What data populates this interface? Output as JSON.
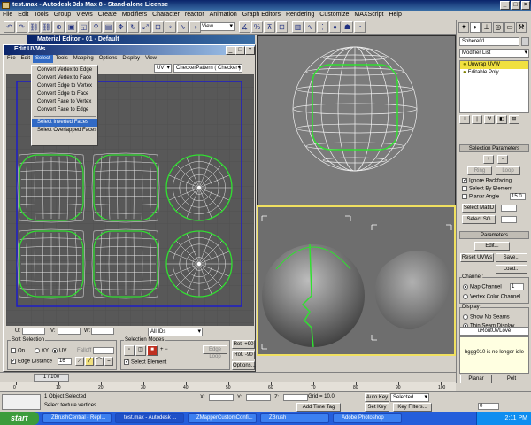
{
  "app": {
    "title": "test.max - Autodesk 3ds Max 8 - Stand-alone License"
  },
  "menu": [
    "File",
    "Edit",
    "Tools",
    "Group",
    "Views",
    "Create",
    "Modifiers",
    "Character",
    "reactor",
    "Animation",
    "Graph Editors",
    "Rendering",
    "Customize",
    "MAXScript",
    "Help"
  ],
  "toolbar": {
    "view_dropdown": "View"
  },
  "material_editor": {
    "title": "Material Editor - 01 - Default"
  },
  "uvw": {
    "title": "Edit UVWs",
    "menu": [
      "File",
      "Edit",
      "Select",
      "Tools",
      "Mapping",
      "Options",
      "Display",
      "View"
    ],
    "uv_dropdown": "UV",
    "checker_dropdown": "CheckerPattern  ( Checker )",
    "select_menu": [
      "Convert Vertex to Edge",
      "Convert Vertex to Face",
      "Convert Edge to Vertex",
      "Convert Edge to Face",
      "Convert Face to Vertex",
      "Convert Face to Edge",
      "Select Inverted Faces",
      "Select Overlapped Faces"
    ],
    "select_menu_selected_index": 6,
    "coords": {
      "u_label": "U:",
      "v_label": "V:",
      "w_label": "W:",
      "ids_dropdown": "All IDs"
    },
    "soft_selection": {
      "title": "Soft Selection",
      "on_label": "On",
      "xy_label": "XY",
      "uv_label": "UV",
      "falloff_label": "Falloff",
      "edge_distance_label": "Edge Distance",
      "edge_distance_value": "16"
    },
    "selection_modes": {
      "title": "Selection Modes",
      "select_element_label": "Select Element",
      "edge_loop_label": "Edge Loop"
    },
    "rotate": {
      "plus90": "Rot. +90",
      "minus90": "Rot. -90"
    },
    "options_label": "Options..."
  },
  "command_panel": {
    "object_name": "Sphere01",
    "modifier_list": "Modifier List",
    "stack": [
      {
        "label": "Unwrap UVW",
        "selected": true
      },
      {
        "label": "Editable Poly",
        "selected": false
      }
    ],
    "selection_params": {
      "title": "Selection Parameters",
      "plus": "+",
      "minus": "-",
      "ring": "Ring",
      "loop": "Loop",
      "ignore_backfacing": "Ignore Backfacing",
      "select_by_element": "Select By Element",
      "planar_angle": "Planar Angle",
      "planar_value": "15.0",
      "select_matid": "Select MatID",
      "select_sg": "Select SG"
    },
    "parameters": {
      "title": "Parameters",
      "edit": "Edit...",
      "reset": "Reset UVWs",
      "save": "Save...",
      "load": "Load...",
      "channel_title": "Channel:",
      "map_channel": "Map Channel",
      "map_channel_value": "1",
      "vertex_color": "Vertex Color Channel",
      "display_title": "Display:",
      "show_no_seams": "Show No Seams",
      "thin_seam": "Thin Seam Display"
    },
    "script_label": "uRoutUVLove",
    "tooltip": "bggg010 is no longer idle",
    "planar": "Planar",
    "pelt": "Pelt"
  },
  "timeline": {
    "frame": "1 / 100",
    "ticks": [
      "0",
      "10",
      "20",
      "30",
      "40",
      "50",
      "60",
      "70",
      "80",
      "90",
      "100"
    ]
  },
  "status": {
    "line1": "1 Object Selected",
    "line2": "Select texture vertices",
    "x_label": "X:",
    "y_label": "Y:",
    "z_label": "Z:",
    "grid": "Grid = 10.0",
    "add_time_tag": "Add Time Tag",
    "auto_key": "Auto Key",
    "selected_dropdown": "Selected",
    "set_key": "Set Key",
    "key_filters": "Key Filters...",
    "frame_value": "0"
  },
  "taskbar": {
    "start": "start",
    "tasks": [
      "ZBrushCentral - Repl...",
      "test.max - Autodesk ...",
      "ZMapperCustomConfi...",
      "ZBrush",
      "Adobe Photoshop"
    ],
    "time": "2:11 PM"
  }
}
